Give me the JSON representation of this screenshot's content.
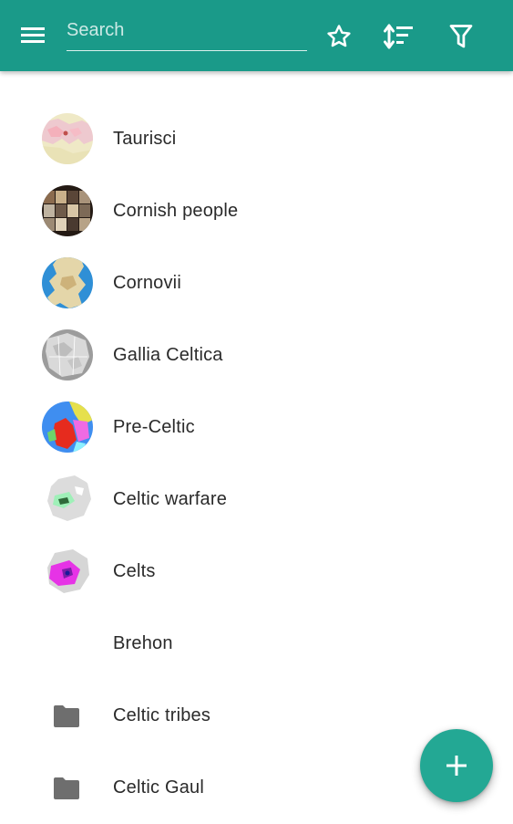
{
  "colors": {
    "app_bar": "#1a9a89",
    "fab": "#23a894",
    "text": "#2a2a2a",
    "folder_icon": "#6e6e6e"
  },
  "toolbar": {
    "menu_icon": "hamburger-menu-icon",
    "search_placeholder": "Search",
    "favorites_icon": "star-outline-icon",
    "sort_icon": "sort-icon",
    "filter_icon": "filter-icon"
  },
  "list": {
    "items": [
      {
        "label": "Taurisci",
        "thumbnail": "map-thumbnail"
      },
      {
        "label": "Cornish people",
        "thumbnail": "portrait-collage-thumbnail"
      },
      {
        "label": "Cornovii",
        "thumbnail": "map-thumbnail"
      },
      {
        "label": "Gallia Celtica",
        "thumbnail": "map-thumbnail"
      },
      {
        "label": "Pre-Celtic",
        "thumbnail": "map-thumbnail"
      },
      {
        "label": "Celtic warfare",
        "thumbnail": "map-thumbnail"
      },
      {
        "label": "Celts",
        "thumbnail": "map-thumbnail"
      },
      {
        "label": "Brehon",
        "thumbnail": "none"
      },
      {
        "label": "Celtic tribes",
        "thumbnail": "folder-icon"
      },
      {
        "label": "Celtic Gaul",
        "thumbnail": "folder-icon"
      }
    ]
  },
  "fab": {
    "icon": "plus-icon"
  }
}
